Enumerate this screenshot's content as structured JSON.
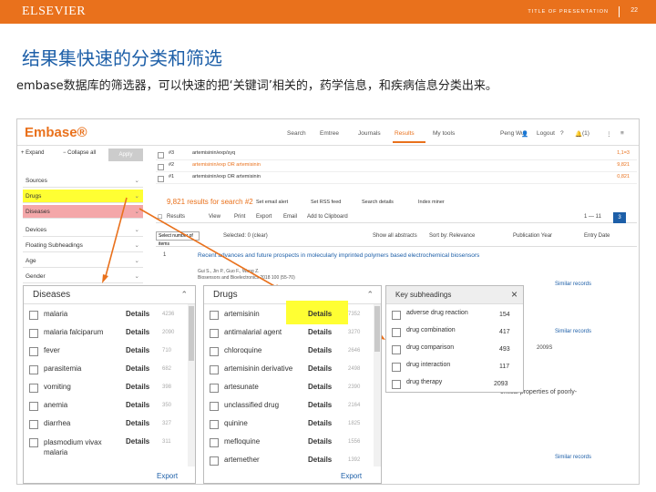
{
  "slide": {
    "brand": "ELSEVIER",
    "presentation_title": "TITLE OF PRESENTATION",
    "page_number": "22",
    "heading": "结果集快速的分类和筛选",
    "body": "embase数据库的筛选器，可以快速的把‘关键词’相关的，药学信息，和疾病信息分类出来。"
  },
  "embase": {
    "logo": "Embase®",
    "nav": [
      "Search",
      "Emtree",
      "Journals",
      "Results",
      "My tools"
    ],
    "active_nav": "Results",
    "user": "Peng Wu",
    "logout": "Logout",
    "help": "?",
    "notifications": "(1)",
    "sidebar": {
      "expand": "+ Expand",
      "collapse": "− Collapse all",
      "apply": "Apply",
      "items": [
        "Sources",
        "Drugs",
        "Diseases",
        "Devices",
        "Floating Subheadings",
        "Age",
        "Gender"
      ]
    },
    "history": [
      {
        "num": "#3",
        "query": "artemisinin/exp/syq",
        "count": "1,1=3"
      },
      {
        "num": "#2",
        "query": "artemisinin/exp OR artemisinin",
        "count": "9,821"
      },
      {
        "num": "#1",
        "query": "artemisinin/exp OR artemisinin",
        "count": "0,821"
      }
    ],
    "results_title": "9,821 results for search #2",
    "toolbar": [
      "Set email alert",
      "Set RSS feed",
      "Search details",
      "Index miner"
    ],
    "results_actions": [
      "Results",
      "View",
      "Print",
      "Export",
      "Email",
      "Add to Clipboard"
    ],
    "pager": "1 — 11",
    "page_current": "3",
    "select_label": "Select number of items",
    "selected": "Selected: 0 (clear)",
    "show_abstracts": "Show all abstracts",
    "sort_by": "Sort by:",
    "sort_options": [
      "Relevance",
      "Publication Year",
      "Entry Date"
    ],
    "article": {
      "index": "1",
      "title": "Recent advances and future prospects in molecularly imprinted polymers based electrochemical biosensors",
      "authors": "Gui S., Jin P., Guo F., Wang Z.",
      "source": "Biosensors and Bioelectronics 2018 100 (55-70)",
      "similar": "Similar records"
    }
  },
  "panels": {
    "diseases": {
      "title": "Diseases",
      "rows": [
        {
          "label": "malaria",
          "count": "4236"
        },
        {
          "label": "malaria falciparum",
          "count": "2090"
        },
        {
          "label": "fever",
          "count": "710"
        },
        {
          "label": "parasitemia",
          "count": "682"
        },
        {
          "label": "vomiting",
          "count": "398"
        },
        {
          "label": "anemia",
          "count": "350"
        },
        {
          "label": "diarrhea",
          "count": "327"
        },
        {
          "label": "plasmodium vivax malaria",
          "count": "311"
        }
      ],
      "details": "Details",
      "export": "Export"
    },
    "drugs": {
      "title": "Drugs",
      "rows": [
        {
          "label": "artemisinin",
          "count": "7352"
        },
        {
          "label": "antimalarial agent",
          "count": "3270"
        },
        {
          "label": "chloroquine",
          "count": "2646"
        },
        {
          "label": "artemisinin derivative",
          "count": "2498"
        },
        {
          "label": "artesunate",
          "count": "2390"
        },
        {
          "label": "unclassified drug",
          "count": "2164"
        },
        {
          "label": "quinine",
          "count": "1825"
        },
        {
          "label": "mefloquine",
          "count": "1556"
        },
        {
          "label": "artemether",
          "count": "1392"
        }
      ],
      "details": "Details",
      "export": "Export"
    },
    "subheadings": {
      "title": "Key subheadings",
      "close": "×",
      "rows": [
        {
          "label": "adverse drug reaction",
          "count": "154"
        },
        {
          "label": "drug combination",
          "count": "417"
        },
        {
          "label": "drug comparison",
          "count": "493"
        },
        {
          "label": "drug interaction",
          "count": "117"
        },
        {
          "label": "drug therapy",
          "count": "2093"
        }
      ]
    },
    "fragments": {
      "behind_text": "critical properties of poorly-",
      "year_left": "2009S"
    }
  },
  "colors": {
    "elsevier_orange": "#e9711c",
    "heading_blue": "#1d5fa8",
    "highlight_yellow": "#ffff33",
    "highlight_red": "#f4a7a9"
  }
}
